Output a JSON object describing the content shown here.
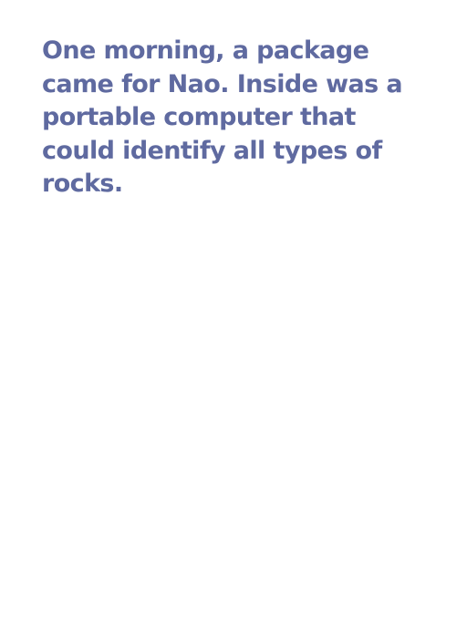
{
  "story": {
    "lines": [
      "One morning, a package",
      "came for Nao. Inside was a",
      "portable computer that",
      "could identify all types of",
      "rocks."
    ]
  },
  "colors": {
    "text": "#5f6aa0",
    "background": "#ffffff"
  }
}
